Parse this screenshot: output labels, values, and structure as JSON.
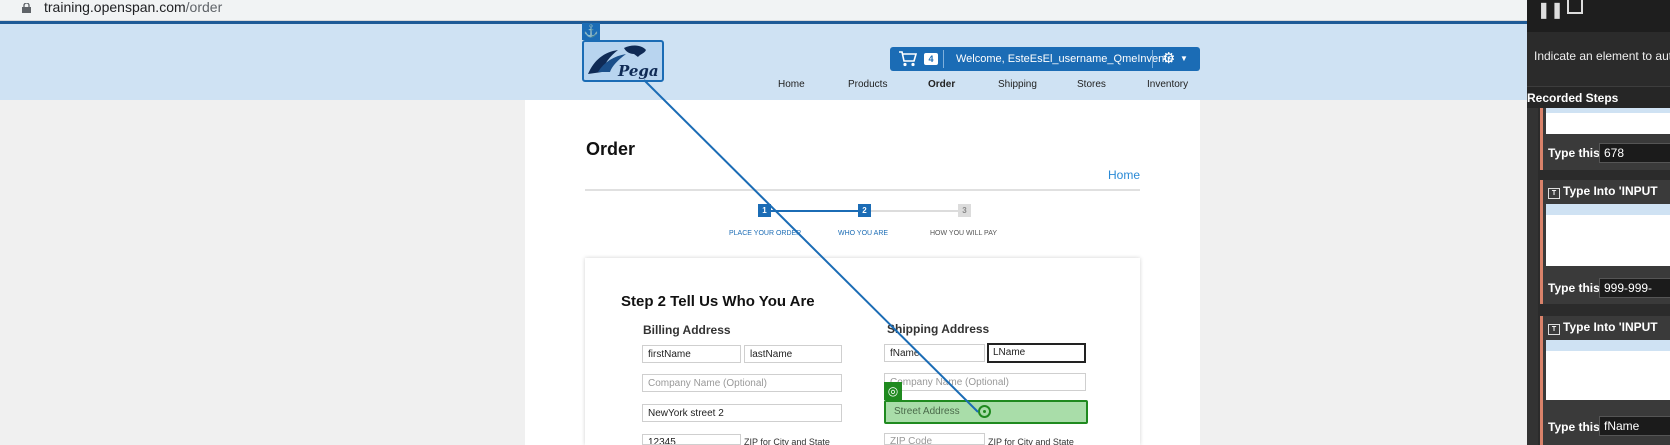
{
  "browser": {
    "url_host": "training.openspan.com",
    "url_path": "/order"
  },
  "header": {
    "cart_count": "4",
    "welcome": "Welcome, EsteEsEl_username_QmeInvente",
    "logo_text": "Pega",
    "nav": [
      "Home",
      "Products",
      "Order",
      "Shipping",
      "Stores",
      "Inventory"
    ]
  },
  "page": {
    "title": "Order",
    "home_link": "Home",
    "steps": [
      {
        "num": "1",
        "label": "PLACE YOUR ORDER"
      },
      {
        "num": "2",
        "label": "WHO YOU ARE"
      },
      {
        "num": "3",
        "label": "HOW YOU WILL PAY"
      }
    ],
    "step_heading": "Step 2 Tell Us Who You Are",
    "billing": {
      "label": "Billing Address",
      "first_name": "firstName",
      "last_name": "lastName",
      "company_placeholder": "Company Name (Optional)",
      "street": "NewYork street 2",
      "zip": "12345",
      "zip_hint": "ZIP for City and State"
    },
    "shipping": {
      "label": "Shipping Address",
      "first_name": "fName",
      "last_name": "LName",
      "company_placeholder": "Company Name (Optional)",
      "street_placeholder": "Street Address",
      "zip_placeholder": "ZIP Code",
      "zip_hint": "ZIP for City and State"
    }
  },
  "recorder": {
    "hint": "Indicate an element to aut",
    "recorded_title": "Recorded Steps",
    "type_this_label": "Type this",
    "steps": [
      {
        "title": "",
        "value": "678"
      },
      {
        "title": "Type Into 'INPUT",
        "value": "999-999-"
      },
      {
        "title": "Type Into 'INPUT",
        "value": "fName"
      }
    ]
  },
  "colors": {
    "accent": "#1b6cb5",
    "header_bg": "#cfe2f3",
    "highlight": "#1f8a1f",
    "step_card_accent": "#d9826a"
  }
}
